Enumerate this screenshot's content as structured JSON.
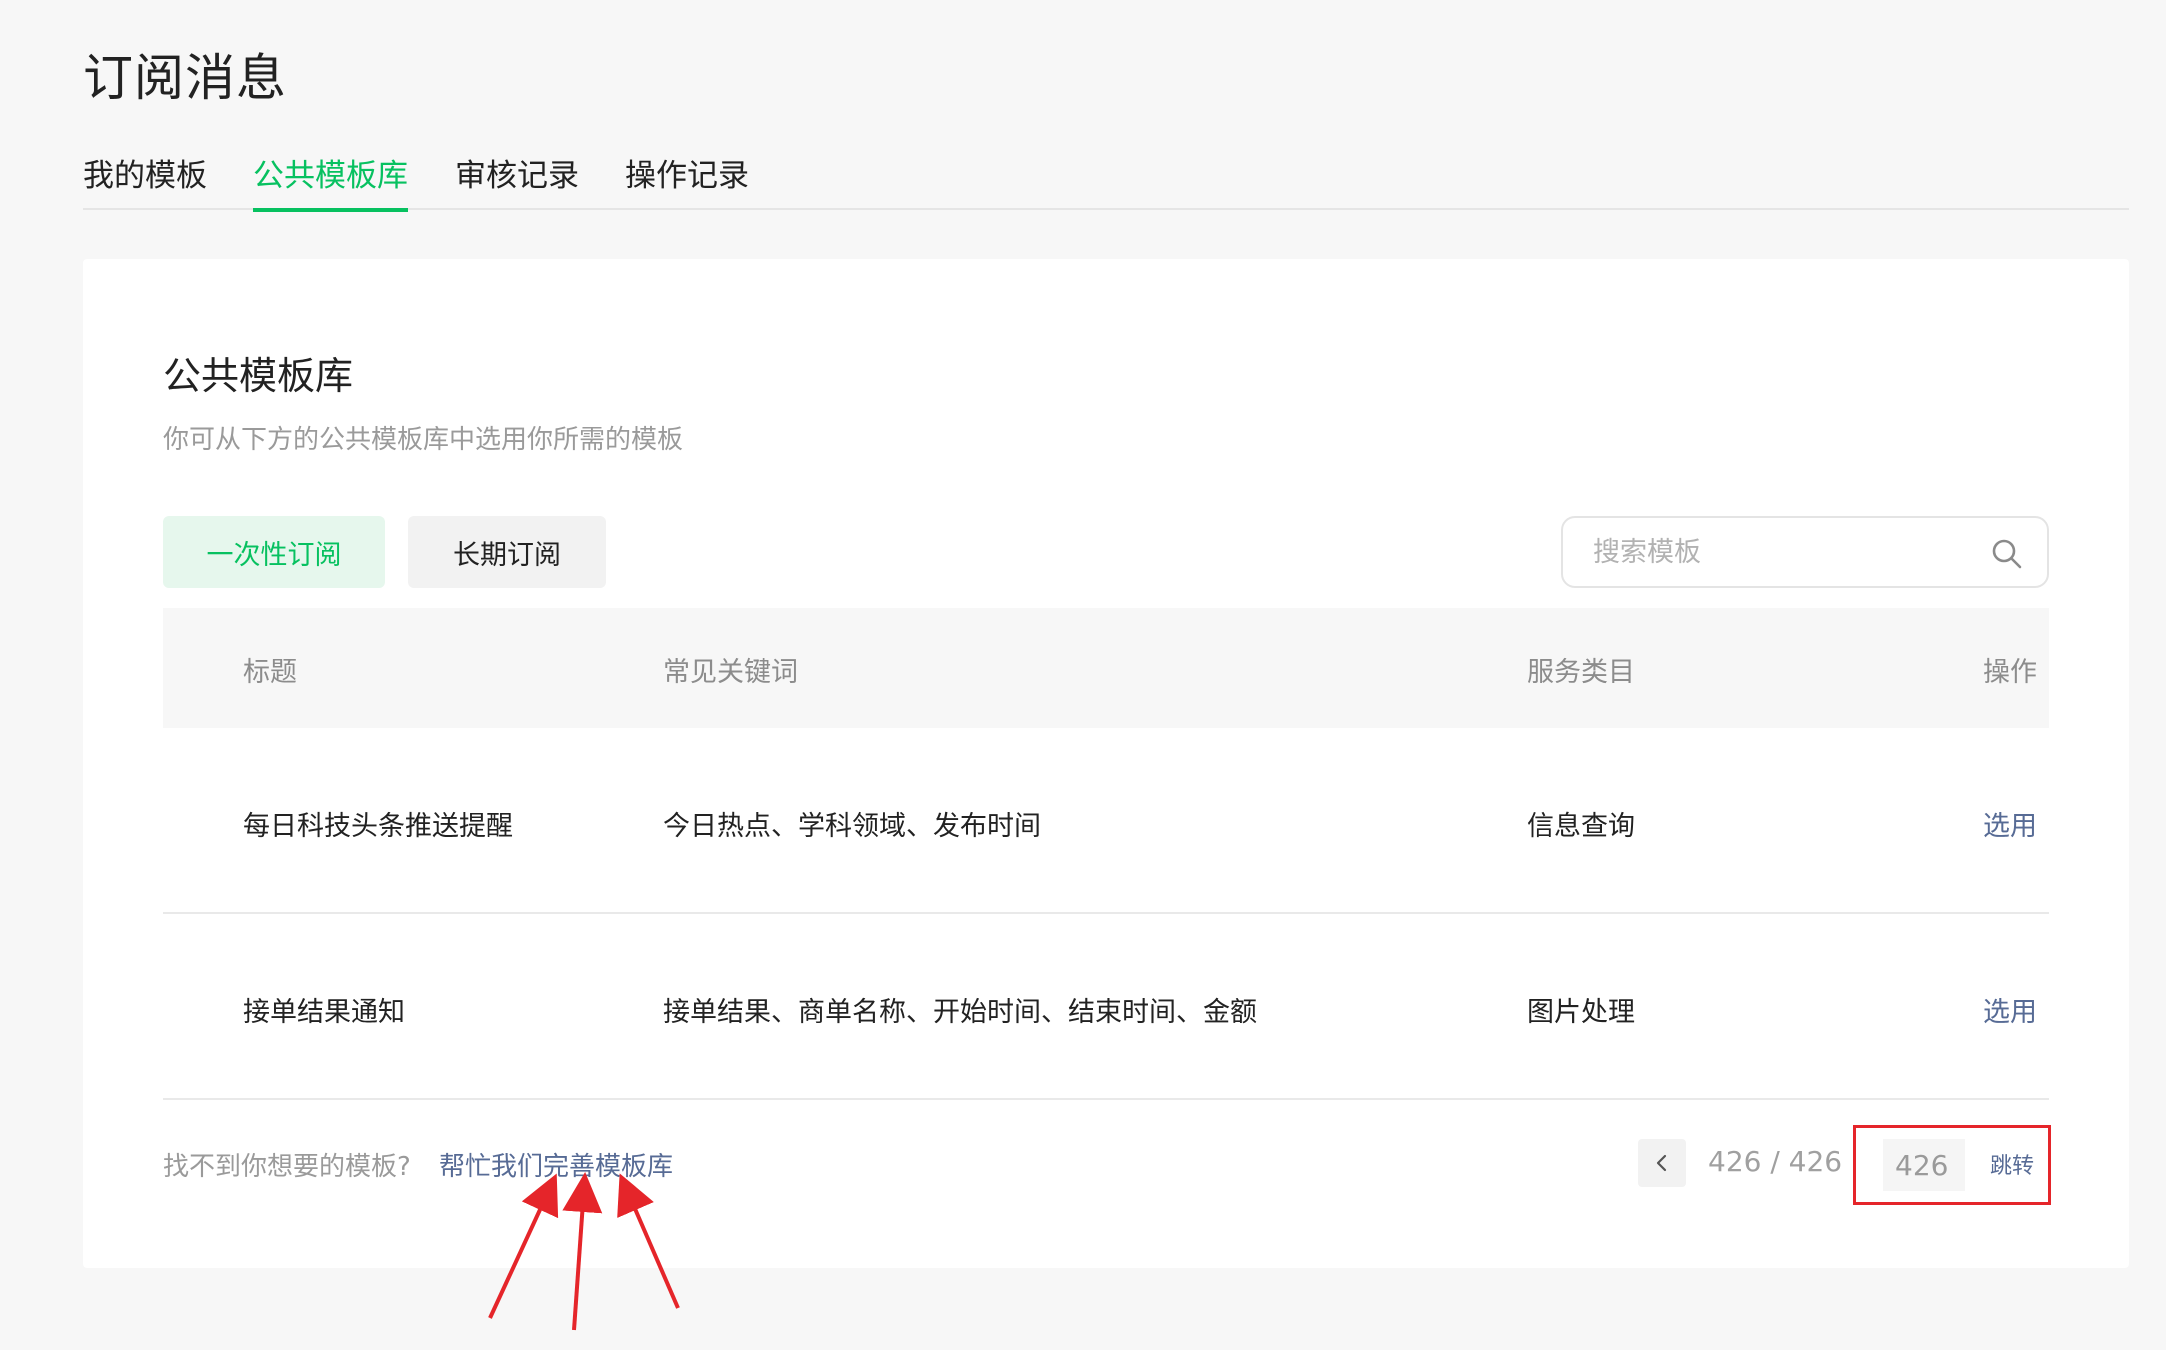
{
  "page": {
    "title": "订阅消息"
  },
  "tabs": [
    {
      "label": "我的模板",
      "active": false
    },
    {
      "label": "公共模板库",
      "active": true
    },
    {
      "label": "审核记录",
      "active": false
    },
    {
      "label": "操作记录",
      "active": false
    }
  ],
  "card": {
    "title": "公共模板库",
    "subtitle": "你可从下方的公共模板库中选用你所需的模板"
  },
  "filters": {
    "one_time": "一次性订阅",
    "long_term": "长期订阅",
    "selected": "one_time"
  },
  "search": {
    "placeholder": "搜索模板",
    "value": ""
  },
  "table": {
    "headers": {
      "title": "标题",
      "keywords": "常见关键词",
      "category": "服务类目",
      "action": "操作"
    },
    "rows": [
      {
        "title": "每日科技头条推送提醒",
        "keywords": "今日热点、学科领域、发布时间",
        "category": "信息查询",
        "action": "选用"
      },
      {
        "title": "接单结果通知",
        "keywords": "接单结果、商单名称、开始时间、结束时间、金额",
        "category": "图片处理",
        "action": "选用"
      }
    ]
  },
  "footer": {
    "note": "找不到你想要的模板?",
    "link": "帮忙我们完善模板库"
  },
  "pagination": {
    "current": 426,
    "total": 426,
    "info": "426 / 426",
    "jump_value": "426",
    "jump_label": "跳转"
  },
  "colors": {
    "accent_green": "#07c160",
    "link_blue": "#576b95",
    "annotation_red": "#e5252a"
  }
}
